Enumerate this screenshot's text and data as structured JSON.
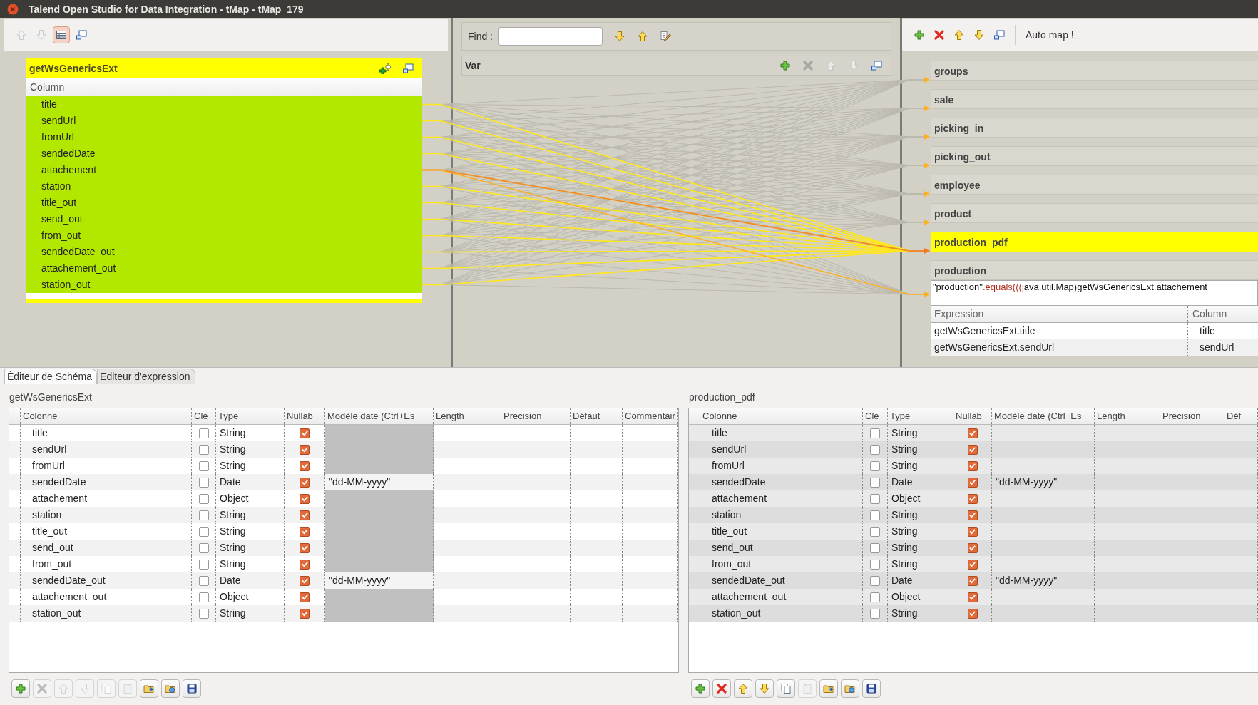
{
  "window": {
    "title": "Talend Open Studio for Data Integration - tMap - tMap_179"
  },
  "input_toolbar": [
    {
      "kind": "up",
      "disabled": true,
      "selected": false
    },
    {
      "kind": "down",
      "disabled": true,
      "selected": false
    },
    {
      "kind": "table",
      "disabled": false,
      "selected": true
    },
    {
      "kind": "minimize",
      "disabled": false,
      "selected": false
    }
  ],
  "input_table": {
    "name": "getWsGenericsExt",
    "header": "Column",
    "buttons": [
      {
        "kind": "add-output",
        "disabled": false
      },
      {
        "kind": "minimize",
        "disabled": false
      }
    ],
    "rows": [
      {
        "name": "title",
        "selected": true
      },
      {
        "name": "sendUrl",
        "selected": true
      },
      {
        "name": "fromUrl",
        "selected": true
      },
      {
        "name": "sendedDate",
        "selected": true
      },
      {
        "name": "attachement",
        "selected": true
      },
      {
        "name": "station",
        "selected": true
      },
      {
        "name": "title_out",
        "selected": true
      },
      {
        "name": "send_out",
        "selected": true
      },
      {
        "name": "from_out",
        "selected": true
      },
      {
        "name": "sendedDate_out",
        "selected": true
      },
      {
        "name": "attachement_out",
        "selected": true
      },
      {
        "name": "station_out",
        "selected": true
      }
    ]
  },
  "find": {
    "label": "Find :",
    "buttons": [
      {
        "kind": "down",
        "disabled": false
      },
      {
        "kind": "up",
        "disabled": false
      },
      {
        "kind": "highlight",
        "disabled": false
      }
    ]
  },
  "var": {
    "title": "Var",
    "buttons": [
      {
        "kind": "add",
        "disabled": false
      },
      {
        "kind": "remove",
        "disabled": true
      },
      {
        "kind": "up",
        "disabled": true
      },
      {
        "kind": "down",
        "disabled": true
      },
      {
        "kind": "minimize",
        "disabled": false
      }
    ]
  },
  "output_toolbar": {
    "buttons": [
      {
        "kind": "add",
        "disabled": false
      },
      {
        "kind": "remove",
        "disabled": false
      },
      {
        "kind": "up",
        "disabled": false
      },
      {
        "kind": "down",
        "disabled": false
      },
      {
        "kind": "minimize",
        "disabled": false
      }
    ],
    "auto_map": "Auto map !"
  },
  "outputs": [
    {
      "name": "groups",
      "selected": false
    },
    {
      "name": "sale",
      "selected": false
    },
    {
      "name": "picking_in",
      "selected": false
    },
    {
      "name": "picking_out",
      "selected": false
    },
    {
      "name": "employee",
      "selected": false
    },
    {
      "name": "product",
      "selected": false
    },
    {
      "name": "production_pdf",
      "selected": true
    },
    {
      "name": "production",
      "selected": false,
      "filter": [
        {
          "text": "\"production\"",
          "kind": "plain"
        },
        {
          "text": ".equals(((",
          "kind": "method"
        },
        {
          "text": "java.util.Map)getWsGenericsExt.attachement",
          "kind": "plain"
        }
      ],
      "expression_table": {
        "columns": [
          "Expression",
          "Column"
        ],
        "rows": [
          {
            "expression": "getWsGenericsExt.title",
            "column": "title"
          },
          {
            "expression": "getWsGenericsExt.sendUrl",
            "column": "sendUrl"
          }
        ]
      }
    }
  ],
  "tabs": [
    {
      "label": "Éditeur de Schéma",
      "selected": true
    },
    {
      "label": "Editeur d'expression",
      "selected": false
    }
  ],
  "schema_editors": [
    {
      "kind": "input",
      "title": "getWsGenericsExt",
      "columns": [
        "Colonne",
        "Clé",
        "Type",
        "Nullab",
        "Modèle date (Ctrl+Es",
        "Length",
        "Precision",
        "Défaut",
        "Commentair"
      ],
      "rows": [
        {
          "colonne": "title",
          "key": false,
          "type": "String",
          "nullable": true
        },
        {
          "colonne": "sendUrl",
          "key": false,
          "type": "String",
          "nullable": true
        },
        {
          "colonne": "fromUrl",
          "key": false,
          "type": "String",
          "nullable": true
        },
        {
          "colonne": "sendedDate",
          "key": false,
          "type": "Date",
          "nullable": true,
          "date_pattern": "\"dd-MM-yyyy\""
        },
        {
          "colonne": "attachement",
          "key": false,
          "type": "Object",
          "nullable": true
        },
        {
          "colonne": "station",
          "key": false,
          "type": "String",
          "nullable": true
        },
        {
          "colonne": "title_out",
          "key": false,
          "type": "String",
          "nullable": true
        },
        {
          "colonne": "send_out",
          "key": false,
          "type": "String",
          "nullable": true
        },
        {
          "colonne": "from_out",
          "key": false,
          "type": "String",
          "nullable": true
        },
        {
          "colonne": "sendedDate_out",
          "key": false,
          "type": "Date",
          "nullable": true,
          "date_pattern": "\"dd-MM-yyyy\""
        },
        {
          "colonne": "attachement_out",
          "key": false,
          "type": "Object",
          "nullable": true
        },
        {
          "colonne": "station_out",
          "key": false,
          "type": "String",
          "nullable": true
        }
      ],
      "buttons": [
        {
          "kind": "add",
          "disabled": false
        },
        {
          "kind": "remove",
          "disabled": true
        },
        {
          "kind": "up",
          "disabled": true
        },
        {
          "kind": "down",
          "disabled": true
        },
        {
          "kind": "copy",
          "disabled": true
        },
        {
          "kind": "paste",
          "disabled": true
        },
        {
          "kind": "import",
          "disabled": false
        },
        {
          "kind": "export",
          "disabled": false
        },
        {
          "kind": "save",
          "disabled": false
        }
      ]
    },
    {
      "kind": "output",
      "title": "production_pdf",
      "columns": [
        "Colonne",
        "Clé",
        "Type",
        "Nullab",
        "Modèle date (Ctrl+Es",
        "Length",
        "Precision",
        "Déf"
      ],
      "rows": [
        {
          "colonne": "title",
          "key": false,
          "type": "String",
          "nullable": true
        },
        {
          "colonne": "sendUrl",
          "key": false,
          "type": "String",
          "nullable": true
        },
        {
          "colonne": "fromUrl",
          "key": false,
          "type": "String",
          "nullable": true
        },
        {
          "colonne": "sendedDate",
          "key": false,
          "type": "Date",
          "nullable": true,
          "date_pattern": "\"dd-MM-yyyy\""
        },
        {
          "colonne": "attachement",
          "key": false,
          "type": "Object",
          "nullable": true
        },
        {
          "colonne": "station",
          "key": false,
          "type": "String",
          "nullable": true
        },
        {
          "colonne": "title_out",
          "key": false,
          "type": "String",
          "nullable": true
        },
        {
          "colonne": "send_out",
          "key": false,
          "type": "String",
          "nullable": true
        },
        {
          "colonne": "from_out",
          "key": false,
          "type": "String",
          "nullable": true
        },
        {
          "colonne": "sendedDate_out",
          "key": false,
          "type": "Date",
          "nullable": true,
          "date_pattern": "\"dd-MM-yyyy\""
        },
        {
          "colonne": "attachement_out",
          "key": false,
          "type": "Object",
          "nullable": true
        },
        {
          "colonne": "station_out",
          "key": false,
          "type": "String",
          "nullable": true
        }
      ],
      "buttons": [
        {
          "kind": "add",
          "disabled": false
        },
        {
          "kind": "remove",
          "disabled": false
        },
        {
          "kind": "up",
          "disabled": false
        },
        {
          "kind": "down",
          "disabled": false
        },
        {
          "kind": "copy",
          "disabled": false
        },
        {
          "kind": "paste",
          "disabled": true
        },
        {
          "kind": "import",
          "disabled": false
        },
        {
          "kind": "export",
          "disabled": false
        },
        {
          "kind": "save",
          "disabled": false
        }
      ]
    }
  ]
}
